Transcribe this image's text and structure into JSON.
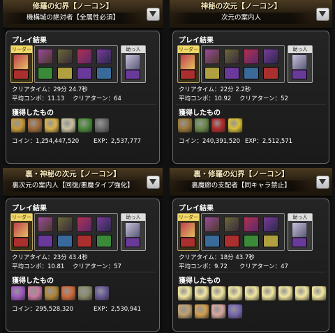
{
  "colors": {
    "header_gold": "#f5e6b8",
    "leader_tag": "#f0d96a",
    "box_border": "#6b6b6b"
  },
  "panels": [
    {
      "dungeon": "修羅の幻界【ノーコン】",
      "floor": "機構城の絶対者【全属性必須】",
      "section_result": "プレイ結果",
      "leader_label": "リーダー",
      "friend_label": "助っ人",
      "clear_time": "クリアタイム：29分 24.7秒",
      "avg_combo": "平均コンボ：11.13",
      "clear_turn": "クリアターン：64",
      "section_drops": "獲得したもの",
      "coin": "コイン：1,254,447,520",
      "exp": "EXP：2,537,777",
      "drop_colors": [
        "#c89a3a",
        "#a06b3a",
        "#d8b24a",
        "#c9c2a0",
        "#4a8a3a",
        "#6c6c6c"
      ]
    },
    {
      "dungeon": "神秘の次元【ノーコン】",
      "floor": "次元の案内人",
      "section_result": "プレイ結果",
      "leader_label": "リーダー",
      "friend_label": "助っ人",
      "clear_time": "クリアタイム：22分 2.2秒",
      "avg_combo": "平均コンボ：10.92",
      "clear_turn": "クリアターン：52",
      "section_drops": "獲得したもの",
      "coin": "コイン：240,391,520",
      "exp": "EXP：2,512,571",
      "drop_colors": [
        "#9a7a3a",
        "#6a8a4a",
        "#b02a2a",
        "#d8c03a"
      ]
    },
    {
      "dungeon": "裏・神秘の次元【ノーコン】",
      "floor": "裏次元の案内人【回復/悪魔タイプ強化】",
      "section_result": "プレイ結果",
      "leader_label": "リーダー",
      "friend_label": "助っ人",
      "clear_time": "クリアタイム：23分 43.4秒",
      "avg_combo": "平均コンボ：10.81",
      "clear_turn": "クリアターン：57",
      "section_drops": "獲得したもの",
      "coin": "コイン：295,528,320",
      "exp": "EXP：2,530,941",
      "drop_colors": [
        "#a05ac0",
        "#c87aa0",
        "#b0883a",
        "#d06a3a",
        "#8a8a6a",
        "#6a5a9a"
      ]
    },
    {
      "dungeon": "裏・修羅の幻界【ノーコン】",
      "floor": "裏魔廊の支配者【同キャラ禁止】",
      "section_result": "プレイ結果",
      "leader_label": "リーダー",
      "friend_label": "助っ人",
      "clear_time": "クリアタイム：18分 43.7秒",
      "avg_combo": "平均コンボ：9.72",
      "clear_turn": "クリアターン：47",
      "section_drops": "獲得したもの",
      "coin": "",
      "exp": "",
      "drop_colors": [
        "#f2e6a0",
        "#f2e6a0",
        "#f2e6a0",
        "#f2e6a0",
        "#f2e6a0",
        "#f2e6a0",
        "#f2e6a0",
        "#f2e6a0",
        "#f2e6a0",
        "#c0a070",
        "#d4a050",
        "#d8a8a0",
        "#7a6ab0"
      ]
    }
  ]
}
